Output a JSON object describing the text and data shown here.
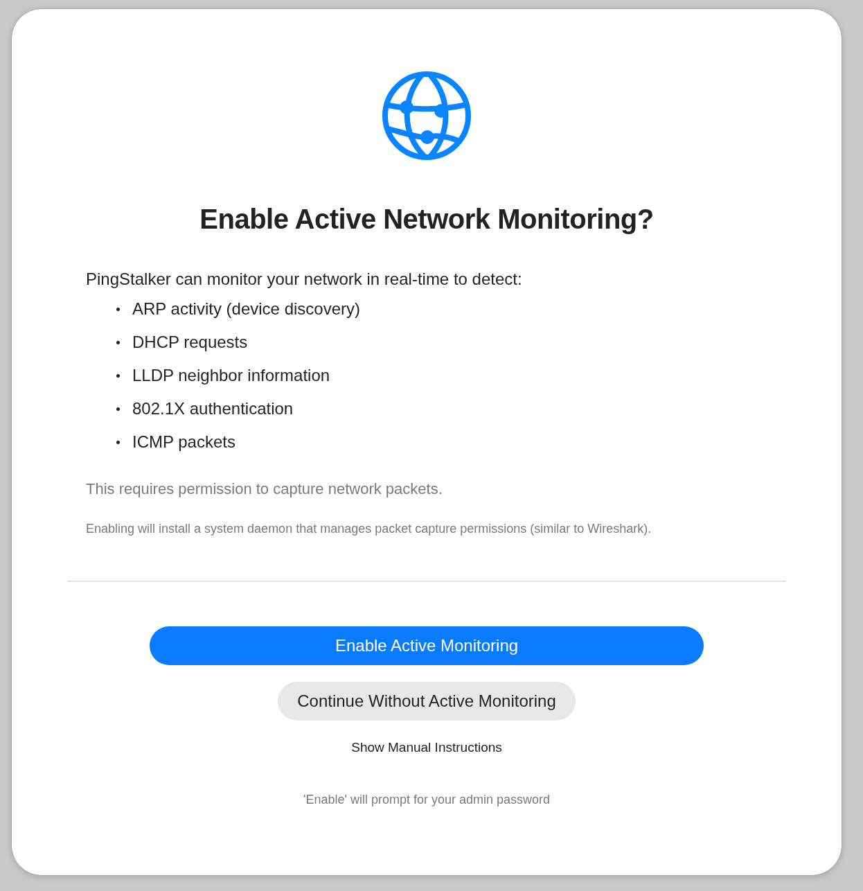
{
  "dialog": {
    "title": "Enable Active Network Monitoring?",
    "intro": "PingStalker can monitor your network in real-time to detect:",
    "features": [
      "ARP activity (device discovery)",
      "DHCP requests",
      "LLDP neighbor information",
      "802.1X authentication",
      "ICMP packets"
    ],
    "permission_note": "This requires permission to capture network packets.",
    "daemon_note": "Enabling will install a system daemon that manages packet capture permissions (similar to Wireshark).",
    "buttons": [
      {
        "label": "Enable Active Monitoring",
        "kind": "primary"
      },
      {
        "label": "Continue Without Active Monitoring",
        "kind": "secondary"
      },
      {
        "label": "Show Manual Instructions",
        "kind": "link"
      }
    ],
    "footer": "'Enable' will prompt for your admin password"
  }
}
